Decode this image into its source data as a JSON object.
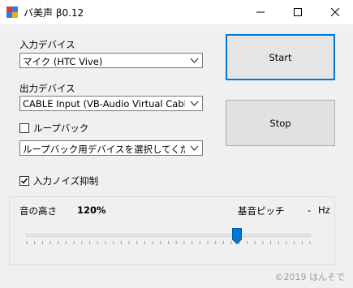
{
  "window": {
    "title": "バ美声 β0.12"
  },
  "input_device": {
    "label": "入力デバイス",
    "selected": "マイク (HTC Vive)"
  },
  "output_device": {
    "label": "出力デバイス",
    "selected": "CABLE Input (VB-Audio Virtual Cable)"
  },
  "loopback": {
    "label": "ループバック",
    "checked": false,
    "device_placeholder": "ループバック用デバイスを選択してください"
  },
  "noise_suppression": {
    "label": "入力ノイズ抑制",
    "checked": true
  },
  "buttons": {
    "start": "Start",
    "stop": "Stop"
  },
  "pitch": {
    "label": "音の高さ",
    "value": "120%",
    "base_label": "基音ピッチ",
    "base_value": "-",
    "base_unit": "Hz",
    "slider_level": 0.74
  },
  "footer": {
    "copyright": "©2019 はんそで"
  },
  "colors": {
    "accent": "#0078d7",
    "background": "#f0f0f0"
  }
}
